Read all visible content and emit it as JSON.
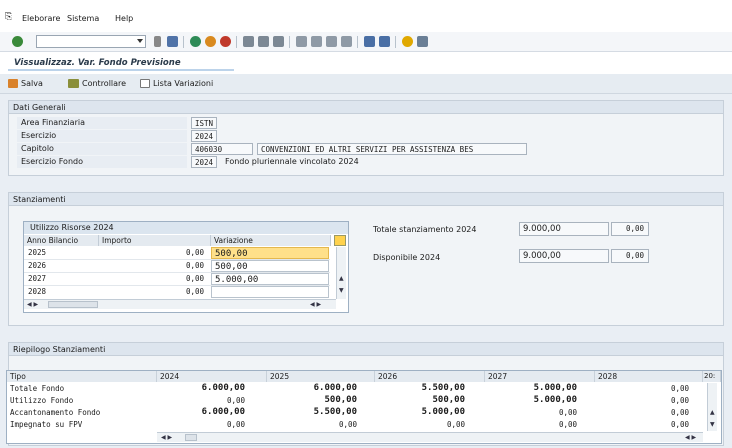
{
  "menu": [
    "Eleborare",
    "Sistema",
    "Help"
  ],
  "screen_title": "Vissualizzaz. Var. Fondo Previsione",
  "app_toolbar": {
    "save": "Salva",
    "check": "Controllare",
    "variations": "Lista Variazioni"
  },
  "dati_generali": {
    "header": "Dati Generali",
    "area_label": "Area Finanziaria",
    "area_value": "ISTN",
    "esercizio_label": "Esercizio",
    "esercizio_value": "2024",
    "capitolo_label": "Capitolo",
    "capitolo_value": "406030",
    "capitolo_desc": "CONVENZIONI ED ALTRI SERVIZI PER ASSISTENZA BES",
    "es_fondo_label": "Esercizio Fondo",
    "es_fondo_value": "2024",
    "es_fondo_desc": "Fondo pluriennale vincolato 2024"
  },
  "stanziamenti": {
    "header": "Stanziamenti",
    "table_title": "Utilizzo Risorse 2024",
    "columns": [
      "Anno Bilancio",
      "Importo",
      "Variazione"
    ],
    "rows": [
      {
        "anno": "2025",
        "importo": "0,00",
        "variazione": "500,00"
      },
      {
        "anno": "2026",
        "importo": "0,00",
        "variazione": "500,00"
      },
      {
        "anno": "2027",
        "importo": "0,00",
        "variazione": "5.000,00"
      },
      {
        "anno": "2028",
        "importo": "0,00",
        "variazione": ""
      }
    ],
    "totale_label": "Totale stanziamento 2024",
    "totale_value": "9.000,00",
    "totale_var": "0,00",
    "disp_label": "Disponibile 2024",
    "disp_value": "9.000,00",
    "disp_var": "0,00"
  },
  "riepilogo": {
    "header": "Riepilogo Stanziamenti",
    "columns": [
      "Tipo",
      "2024",
      "2025",
      "2026",
      "2027",
      "2028",
      "20:"
    ],
    "rows": [
      {
        "tipo": "Totale Fondo",
        "v": [
          "6.000,00",
          "6.000,00",
          "5.500,00",
          "5.000,00",
          "0,00"
        ]
      },
      {
        "tipo": "Utilizzo Fondo",
        "v": [
          "0,00",
          "500,00",
          "500,00",
          "5.000,00",
          "0,00"
        ]
      },
      {
        "tipo": "Accantonamento Fondo",
        "v": [
          "6.000,00",
          "5.500,00",
          "5.000,00",
          "0,00",
          "0,00"
        ]
      },
      {
        "tipo": "Impegnato su FPV",
        "v": [
          "0,00",
          "0,00",
          "0,00",
          "0,00",
          "0,00"
        ]
      }
    ]
  }
}
